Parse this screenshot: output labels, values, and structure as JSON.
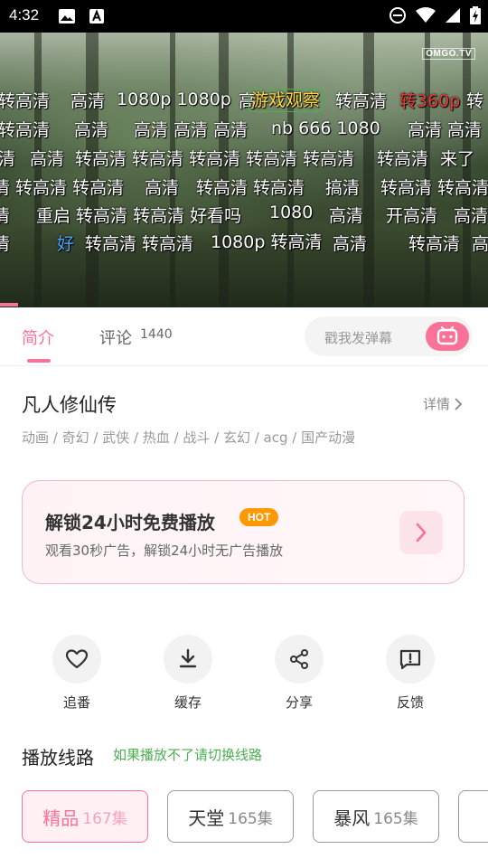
{
  "status_bar": {
    "time": "4:32"
  },
  "video": {
    "watermark": "OMGO.TV",
    "danmaku": [
      [
        "转高清",
        "高清",
        "1080p 1080p",
        "高",
        "游戏观察",
        "转高清",
        "转360p",
        "转"
      ],
      [
        "转高清",
        "高清",
        "高清 高清 高清",
        "nb 666 1080",
        "高清 高清"
      ],
      [
        "清",
        "高清",
        "转高清 转高清 转高清 转高清 转高清",
        "转高清",
        "来了"
      ],
      [
        "清 转高清 转高清",
        "高清",
        "转高清 转高清",
        "搞清",
        "转高清 转高清"
      ],
      [
        "清",
        "重启 转高清 转高清 好看吗",
        "1080",
        "高清",
        "开高清",
        "高清"
      ],
      [
        "清",
        "好",
        "转高清 转高清",
        "1080p 转高清",
        "高清",
        "转高清",
        "高"
      ]
    ]
  },
  "tabs": {
    "intro": "简介",
    "comments": "评论",
    "comments_count": "1440",
    "danmaku_placeholder": "戳我发弹幕"
  },
  "show": {
    "title": "凡人修仙传",
    "details": "详情",
    "tags": "动画 / 奇幻 / 武侠 / 热血 / 战斗 / 玄幻 / acg / 国产动漫"
  },
  "promo": {
    "title": "解锁24小时免费播放",
    "badge": "HOT",
    "subtitle": "观看30秒广告，解锁24小时无广告播放"
  },
  "actions": [
    {
      "label": "追番",
      "icon": "heart-icon"
    },
    {
      "label": "缓存",
      "icon": "download-icon"
    },
    {
      "label": "分享",
      "icon": "share-icon"
    },
    {
      "label": "反馈",
      "icon": "feedback-icon"
    }
  ],
  "routes": {
    "title": "播放线路",
    "hint": "如果播放不了请切换线路",
    "items": [
      {
        "name": "精品",
        "count": "167集",
        "active": true
      },
      {
        "name": "天堂",
        "count": "165集",
        "active": false
      },
      {
        "name": "暴风",
        "count": "165集",
        "active": false
      }
    ]
  },
  "colors": {
    "accent": "#fb7299",
    "hint_green": "#4caf50",
    "hot_orange": "#ff9800"
  }
}
